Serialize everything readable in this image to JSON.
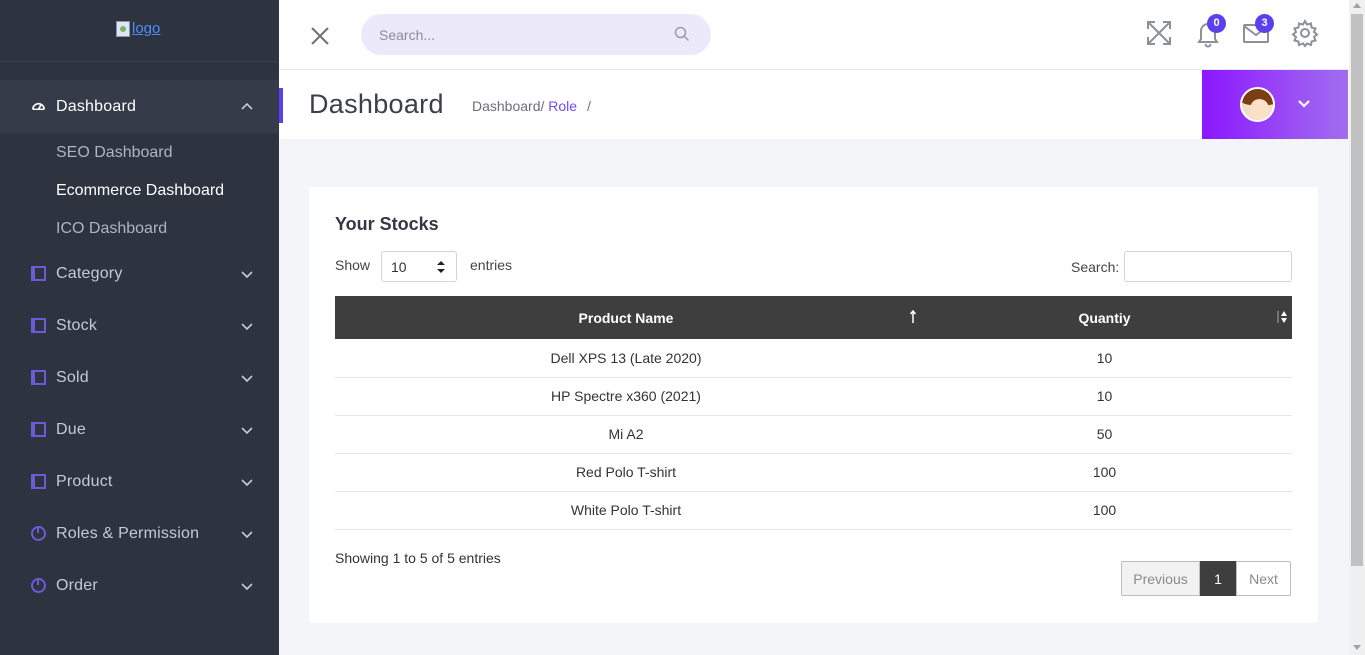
{
  "logo": {
    "alt": "logo"
  },
  "sidebar": {
    "items": [
      {
        "label": "Dashboard",
        "icon": "dashboard-gauge-icon"
      },
      {
        "label": "Category",
        "icon": "book-icon"
      },
      {
        "label": "Stock",
        "icon": "book-icon"
      },
      {
        "label": "Sold",
        "icon": "book-icon"
      },
      {
        "label": "Due",
        "icon": "book-icon"
      },
      {
        "label": "Product",
        "icon": "book-icon"
      },
      {
        "label": "Roles & Permission",
        "icon": "pie-chart-icon"
      },
      {
        "label": "Order",
        "icon": "pie-chart-icon"
      }
    ],
    "submenu": [
      {
        "label": "SEO Dashboard"
      },
      {
        "label": "Ecommerce Dashboard"
      },
      {
        "label": "ICO Dashboard"
      }
    ]
  },
  "header": {
    "search_placeholder": "Search...",
    "notifications_count": "0",
    "messages_count": "3"
  },
  "page": {
    "title": "Dashboard",
    "breadcrumb": {
      "first": "Dashboard/",
      "second": "Role",
      "trailing": "/"
    }
  },
  "card": {
    "title": "Your Stocks",
    "show_label": "Show",
    "entries_value": "10",
    "entries_label": "entries",
    "search_label": "Search:",
    "columns": [
      "Product Name",
      "Quantiy"
    ],
    "rows": [
      {
        "name": "Dell XPS 13 (Late 2020)",
        "qty": "10"
      },
      {
        "name": "HP Spectre x360 (2021)",
        "qty": "10"
      },
      {
        "name": "Mi A2",
        "qty": "50"
      },
      {
        "name": "Red Polo T-shirt",
        "qty": "100"
      },
      {
        "name": "White Polo T-shirt",
        "qty": "100"
      }
    ],
    "info": "Showing 1 to 5 of 5 entries",
    "pagination": {
      "prev": "Previous",
      "page": "1",
      "next": "Next"
    }
  },
  "colors": {
    "sidebar_bg": "#2e3340",
    "accent": "#5b40f0",
    "user_gradient_start": "#8b16ff",
    "table_header": "#3e3e3e"
  }
}
